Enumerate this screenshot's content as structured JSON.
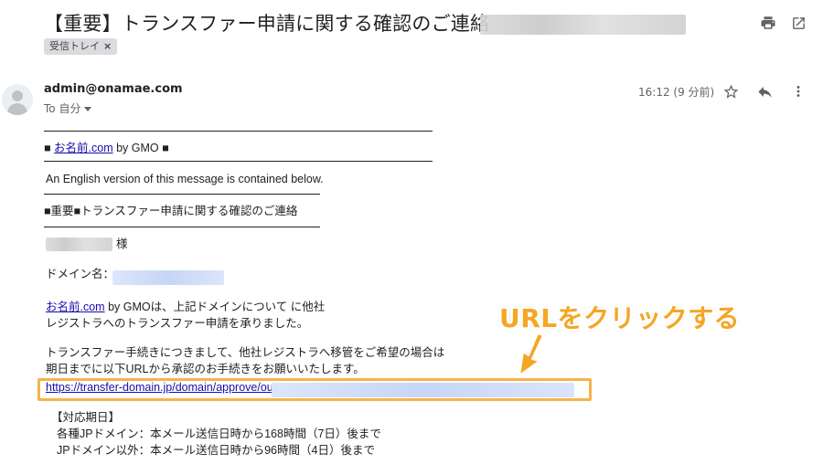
{
  "subject": "【重要】トランスファー申請に関する確認のご連絡",
  "label_chip": {
    "text": "受信トレイ",
    "close": "×"
  },
  "sender": {
    "address": "admin@onamae.com",
    "to_label": "To 自分"
  },
  "time": "16:12 (9 分前)",
  "icons": {
    "print": "print-icon",
    "open_new": "open-in-new-icon",
    "star": "star-icon",
    "reply": "reply-icon",
    "more": "more-vert-icon"
  },
  "body": {
    "brand_prefix": "■ ",
    "brand_link": "お名前.com",
    "brand_suffix": " by GMO ■",
    "english_note": "An English version of this message is contained below.",
    "heading": "■重要■トランスファー申請に関する確認のご連絡",
    "honorific": "様",
    "domain_label": "ドメイン名：",
    "para1_link": "お名前.com",
    "para1_line1": " by GMOは、上記ドメインについて に他社",
    "para1_line2": "レジストラへのトランスファー申請を承りました。",
    "para2_line1": "トランスファー手続きにつきまして、他社レジストラへ移管をご希望の場合は",
    "para2_line2": "期日までに以下URLから承認のお手続きをお願いいたします。",
    "approve_url": "https://transfer-domain.jp/domain/approve/out",
    "period_heading": "【対応期日】",
    "period_line1": "各種JPドメイン：本メール送信日時から168時間（7日）後まで",
    "period_line2": "JPドメイン以外：本メール送信日時から96時間（4日）後まで"
  },
  "annotation": {
    "callout": "URLをクリックする"
  },
  "colors": {
    "link": "#1a0dab",
    "highlight": "#f6b34a",
    "callout": "#f5a623"
  }
}
